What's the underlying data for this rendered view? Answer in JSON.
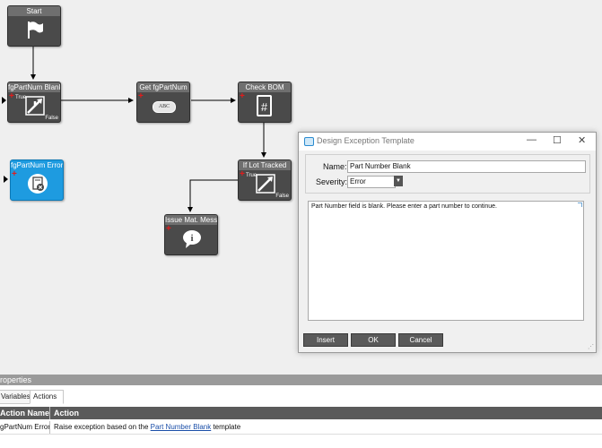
{
  "canvas": {
    "nodes": [
      {
        "id": "start",
        "title": "Start",
        "icon": "flag-icon"
      },
      {
        "id": "fgpartnum-blank",
        "title": "fgPartNum Blank",
        "icon": "branch-icon",
        "true_label": "True",
        "false_label": "False"
      },
      {
        "id": "get-fgpartnum",
        "title": "Get fgPartNum",
        "icon": "abc-icon",
        "icon_text": "ABC"
      },
      {
        "id": "check-bom",
        "title": "Check BOM",
        "icon": "document-hash-icon",
        "icon_text": "#"
      },
      {
        "id": "if-lot-tracked",
        "title": "If Lot Tracked",
        "icon": "branch-icon",
        "true_label": "True",
        "false_label": "False"
      },
      {
        "id": "issue-mat-message",
        "title": "Issue Mat. Messag",
        "icon": "info-icon",
        "icon_text": "i"
      },
      {
        "id": "fgpartnum-error",
        "title": "fgPartNum Error",
        "icon": "exception-icon"
      }
    ]
  },
  "dialog": {
    "title": "Design Exception Template",
    "name_label": "Name:",
    "name_value": "Part Number Blank",
    "severity_label": "Severity:",
    "severity_value": "Error",
    "message": "Part Number field is blank. Please enter a part number to continue.",
    "insert_label": "Insert",
    "ok_label": "OK",
    "cancel_label": "Cancel",
    "minimize_symbol": "—",
    "maximize_symbol": "☐",
    "close_symbol": "✕"
  },
  "properties": {
    "header": "roperties",
    "tabs": [
      "Variables",
      "Actions"
    ],
    "columns": [
      "Action Name",
      "Action"
    ],
    "rows": [
      {
        "name": "gPartNum Error",
        "action_prefix": "Raise exception based on the ",
        "action_link": "Part Number Blank",
        "action_suffix": " template"
      }
    ]
  },
  "colors": {
    "node": "#4a4a4a",
    "selected_node": "#1e9be0",
    "accent_red": "#e21b1b",
    "link": "#1a4ea8"
  }
}
